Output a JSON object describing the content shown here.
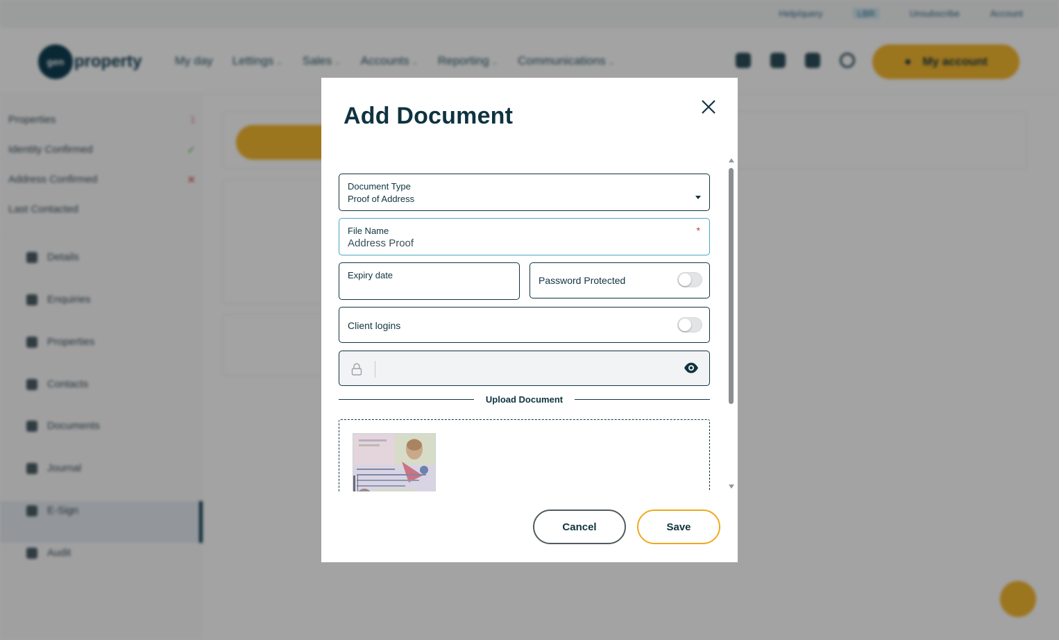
{
  "background": {
    "top_links": [
      "Help/query",
      "LBR",
      "Unsubscribe",
      "Account"
    ],
    "logo_text": "property",
    "logo_badge": "gen",
    "main_nav": [
      "My day",
      "Lettings",
      "Sales",
      "Accounts",
      "Reporting",
      "Communications"
    ],
    "account_button": "My account",
    "sidebar_info": [
      {
        "label": "Properties",
        "mark": "1"
      },
      {
        "label": "Identity Confirmed",
        "mark": "✓"
      },
      {
        "label": "Address Confirmed",
        "mark": "✕"
      },
      {
        "label": "Last Contacted",
        "mark": ""
      }
    ],
    "sidebar_items": [
      "Details",
      "Enquiries",
      "Properties",
      "Contacts",
      "Documents",
      "Journal",
      "E-Sign",
      "Audit"
    ]
  },
  "modal": {
    "title": "Add Document",
    "document_type": {
      "label": "Document Type",
      "value": "Proof of Address"
    },
    "file_name": {
      "label": "File Name",
      "value": "Address Proof",
      "required_mark": "*"
    },
    "expiry_date": {
      "label": "Expiry date",
      "value": ""
    },
    "password_protected": {
      "label": "Password Protected",
      "on": false
    },
    "client_logins": {
      "label": "Client logins",
      "on": false
    },
    "password_field": {
      "value": ""
    },
    "upload_title": "Upload Document",
    "cancel_label": "Cancel",
    "save_label": "Save"
  },
  "colors": {
    "primary_text": "#0f3340",
    "accent": "#f5b731",
    "focus_border": "#45a5c2",
    "required": "#d0312d"
  }
}
